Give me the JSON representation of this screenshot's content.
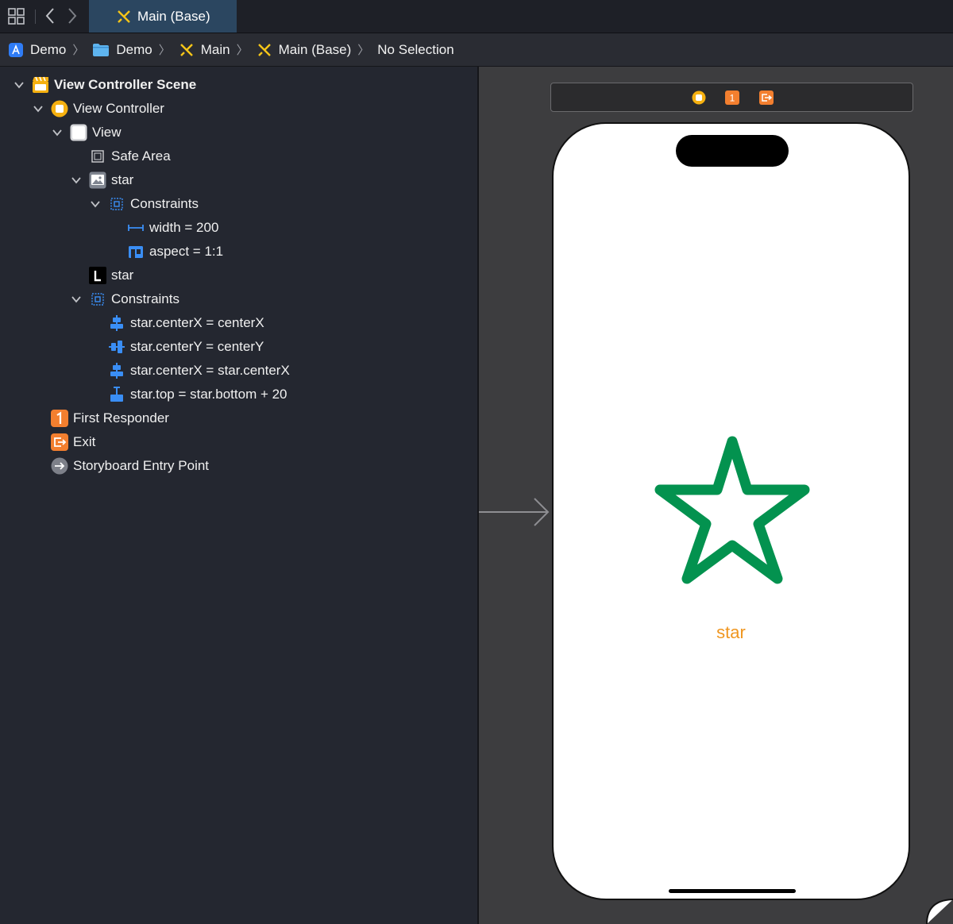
{
  "tab": {
    "title": "Main (Base)"
  },
  "breadcrumb": [
    {
      "label": "Demo",
      "icon": "app-icon"
    },
    {
      "label": "Demo",
      "icon": "folder-icon"
    },
    {
      "label": "Main",
      "icon": "storyboard-icon"
    },
    {
      "label": "Main (Base)",
      "icon": "storyboard-icon"
    },
    {
      "label": "No Selection",
      "icon": ""
    }
  ],
  "outline": {
    "scene": "View Controller Scene",
    "view_controller": "View Controller",
    "view": "View",
    "safe_area": "Safe Area",
    "image_star": "star",
    "image_constraints": "Constraints",
    "width_constraint": "width = 200",
    "aspect_constraint": "aspect = 1:1",
    "label_star": "star",
    "view_constraints": "Constraints",
    "constraints": [
      "star.centerX = centerX",
      "star.centerY = centerY",
      "star.centerX = star.centerX",
      "star.top = star.bottom + 20"
    ],
    "first_responder": "First Responder",
    "exit": "Exit",
    "entry_point": "Storyboard Entry Point"
  },
  "canvas": {
    "scene_bar_first_responder_badge": "1",
    "star_label": "star",
    "colors": {
      "star_stroke": "#03924f",
      "label_text": "#f0961f",
      "view_controller_icon": "#f5b010",
      "first_responder_icon": "#f37f2f",
      "constraint_icon": "#3a8ef5"
    }
  }
}
